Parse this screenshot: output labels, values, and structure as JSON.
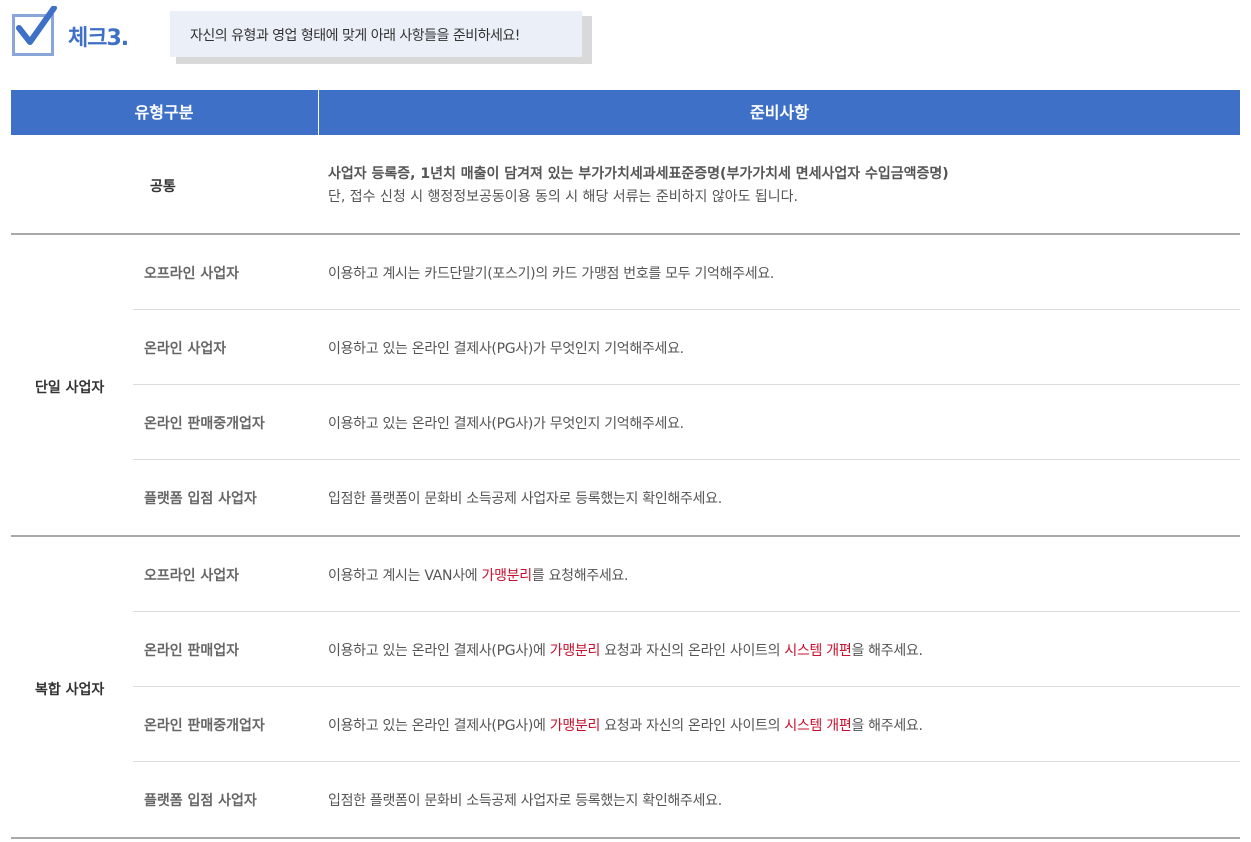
{
  "header": {
    "title": "체크3.",
    "callout": "자신의 유형과 영업 형태에 맞게 아래 사항들을 준비하세요!"
  },
  "table": {
    "col_type": "유형구분",
    "col_prep": "준비사항",
    "common": {
      "label": "공통",
      "line1": "사업자 등록증, 1년치 매출이 담겨져 있는 부가가치세과세표준증명(부가가치세 면세사업자 수입금액증명)",
      "line2": "단, 접수 신청 시 행정정보공동이용 동의 시 해당 서류는 준비하지 않아도 됩니다."
    },
    "single": {
      "label": "단일 사업자",
      "rows": [
        {
          "type": "오프라인 사업자",
          "text": "이용하고 계시는 카드단말기(포스기)의 카드 가맹점 번호를 모두 기억해주세요."
        },
        {
          "type": "온라인 사업자",
          "text": "이용하고 있는 온라인 결제사(PG사)가 무엇인지 기억해주세요."
        },
        {
          "type": "온라인 판매중개업자",
          "text": "이용하고 있는 온라인 결제사(PG사)가 무엇인지 기억해주세요."
        },
        {
          "type": "플랫폼 입점 사업자",
          "text": "입점한 플랫폼이 문화비 소득공제 사업자로 등록했는지 확인해주세요."
        }
      ]
    },
    "complex": {
      "label": "복합 사업자",
      "rows": [
        {
          "type": "오프라인 사업자",
          "a": "이용하고 계시는 VAN사에 ",
          "b": "가맹분리",
          "c": "를 요청해주세요."
        },
        {
          "type": "온라인 판매업자",
          "a": "이용하고 있는 온라인 결제사(PG사)에 ",
          "b": "가맹분리",
          "c": " 요청과 자신의 온라인 사이트의 ",
          "d": "시스템 개편",
          "e": "을 해주세요."
        },
        {
          "type": "온라인 판매중개업자",
          "a": "이용하고 있는 온라인 결제사(PG사)에 ",
          "b": "가맹분리",
          "c": " 요청과 자신의 온라인 사이트의 ",
          "d": "시스템 개편",
          "e": "을 해주세요."
        },
        {
          "type": "플랫폼 입점 사업자",
          "text": "입점한 플랫폼이 문화비 소득공제 사업자로 등록했는지 확인해주세요."
        }
      ]
    }
  },
  "colors": {
    "header_blue": "#3f70c7",
    "highlight_red": "#c8102e",
    "callout_bg": "#ebf0f8"
  }
}
